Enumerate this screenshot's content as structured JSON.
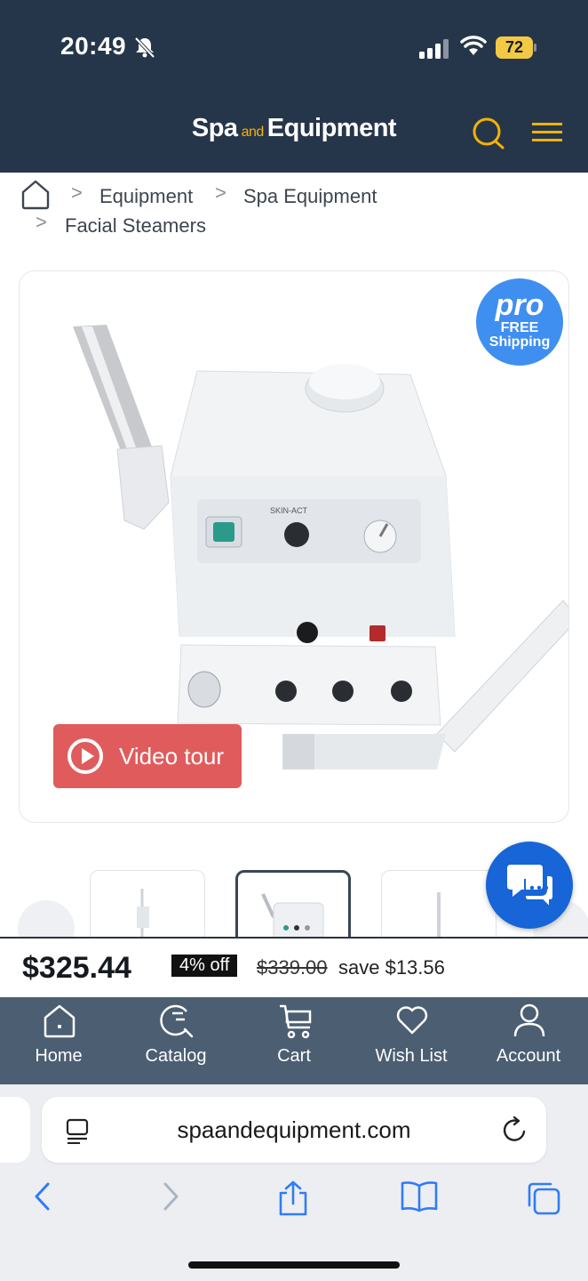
{
  "status_bar": {
    "time": "20:49",
    "battery": "72"
  },
  "header": {
    "logo_part1": "Spa",
    "logo_part2": "and",
    "logo_part3": "Equipment"
  },
  "breadcrumb": {
    "items": [
      "Equipment",
      "Spa Equipment",
      "Facial Steamers"
    ]
  },
  "product_image": {
    "badge_pro": "pro",
    "badge_free": "FREE",
    "badge_shipping": "Shipping",
    "panel_brand": "SKIN-ACT",
    "video_label": "Video tour"
  },
  "price_bar": {
    "price": "$325.44",
    "discount": "4% off",
    "old_price": "$339.00",
    "save": "save $13.56"
  },
  "bottom_nav": {
    "items": [
      {
        "label": "Home",
        "icon": "house-icon"
      },
      {
        "label": "Catalog",
        "icon": "catalog-search-icon"
      },
      {
        "label": "Cart",
        "icon": "cart-icon"
      },
      {
        "label": "Wish List",
        "icon": "heart-icon"
      },
      {
        "label": "Account",
        "icon": "user-icon"
      }
    ]
  },
  "browser": {
    "url": "spaandequipment.com"
  },
  "colors": {
    "header_bg": "#26364a",
    "accent_gold": "#f6b200",
    "nav_bg": "#4b5e72",
    "video_button": "#e05c5c",
    "pro_badge": "#3f8ff0",
    "chat_button": "#1765d6",
    "ios_blue": "#2f7cf6"
  }
}
